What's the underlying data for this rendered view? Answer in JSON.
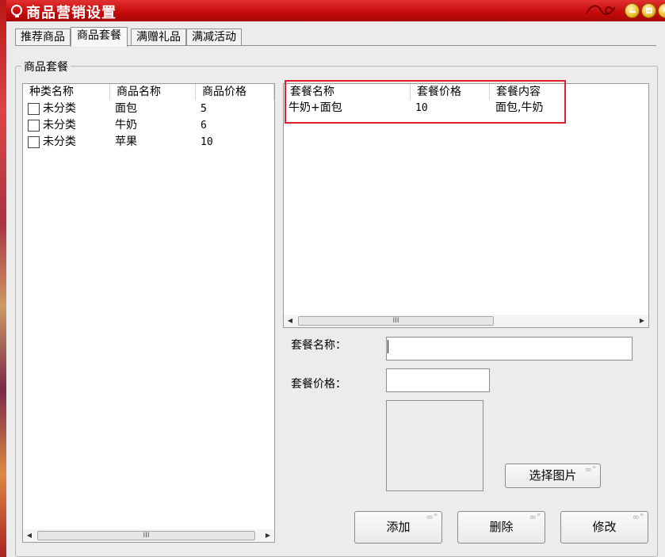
{
  "window": {
    "title": "商品营销设置",
    "buttons": {
      "minimize": "minimize",
      "maximize": "maximize",
      "close": "close"
    }
  },
  "tabs": [
    {
      "label": "推荐商品",
      "active": false
    },
    {
      "label": "商品套餐",
      "active": true
    },
    {
      "label": "满赠礼品",
      "active": false
    },
    {
      "label": "满减活动",
      "active": false
    }
  ],
  "group": {
    "legend": "商品套餐"
  },
  "product_list": {
    "columns": [
      "种类名称",
      "商品名称",
      "商品价格"
    ],
    "rows": [
      {
        "category": "未分类",
        "name": "面包",
        "price": "5",
        "checked": false
      },
      {
        "category": "未分类",
        "name": "牛奶",
        "price": "6",
        "checked": false
      },
      {
        "category": "未分类",
        "name": "苹果",
        "price": "10",
        "checked": false
      }
    ],
    "scroll_thumb": "III"
  },
  "package_list": {
    "columns": [
      "套餐名称",
      "套餐价格",
      "套餐内容"
    ],
    "rows": [
      {
        "name": "牛奶+面包",
        "price": "10",
        "content": "面包,牛奶"
      }
    ],
    "scroll_thumb": "III"
  },
  "form": {
    "name_label": "套餐名称：",
    "name_value": "",
    "price_label": "套餐价格：",
    "price_value": "",
    "choose_image": "选择图片"
  },
  "actions": {
    "add": "添加",
    "delete": "删除",
    "modify": "修改"
  },
  "colors": {
    "titlebar": "#c70c0c",
    "highlight": "#e0202a",
    "window_bg": "#ececec"
  },
  "icons": [
    "app-icon",
    "minimize-icon",
    "maximize-icon",
    "close-icon",
    "scroll-left-icon",
    "scroll-right-icon"
  ]
}
